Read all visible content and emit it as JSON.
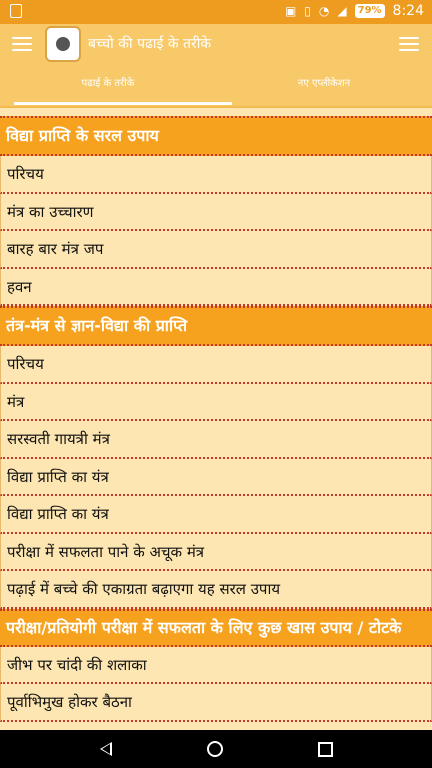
{
  "status": {
    "battery": "79%",
    "time": "8:24"
  },
  "appbar": {
    "title": "बच्चो की पढाई के तरीके"
  },
  "tabs": [
    {
      "label": "पढाई के तरीके"
    },
    {
      "label": "नए एप्लीकेशन"
    }
  ],
  "sections": [
    {
      "title": "विद्या प्राप्ति के सरल उपाय",
      "items": [
        "परिचय",
        "मंत्र का उच्चारण",
        "बारह बार मंत्र जप",
        "हवन"
      ]
    },
    {
      "title": "तंत्र-मंत्र से ज्ञान-विद्या की प्राप्ति",
      "items": [
        "परिचय",
        "मंत्र",
        "सरस्वती गायत्री मंत्र",
        "विद्या प्राप्ति का यंत्र",
        "विद्या प्राप्ति का यंत्र",
        "परीक्षा में सफलता पाने के अचूक मंत्र",
        "पढ़ाई में बच्चे की एकाग्रता बढ़ाएगा यह सरल उपाय"
      ]
    },
    {
      "title": "परीक्षा/प्रतियोगी परीक्षा में सफलता के लिए कुछ खास उपाय / टोटके",
      "items": [
        "जीभ पर चांदी की शलाका",
        "पूर्वाभिमुख होकर बैठना"
      ]
    }
  ]
}
